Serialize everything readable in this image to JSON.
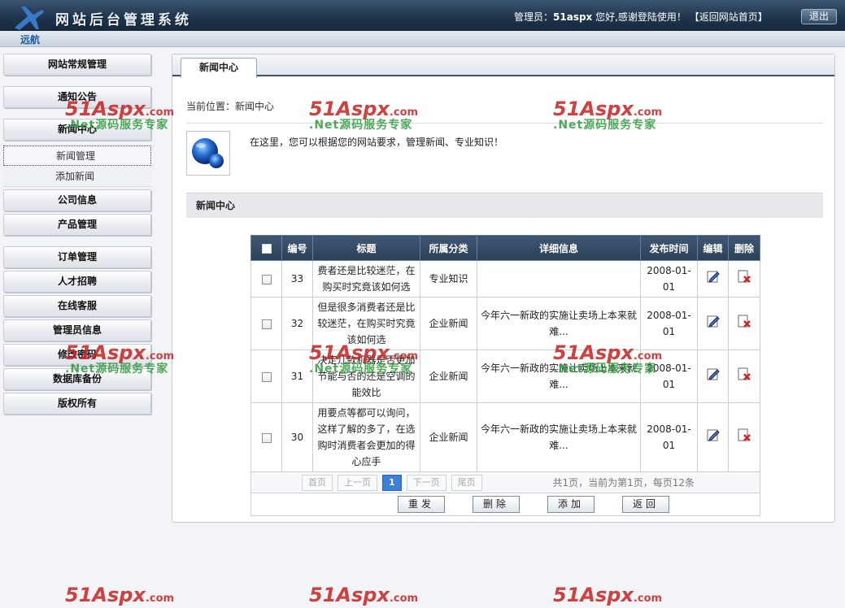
{
  "header": {
    "system_title": "网站后台管理系统",
    "logo_text": "远航",
    "admin_label": "管理员：",
    "admin_name": "51aspx",
    "greeting": " 您好,感谢登陆使用！",
    "home_link": "【返回网站首页】",
    "logout_label": "退出"
  },
  "sidebar": {
    "items": [
      {
        "label": "网站常规管理"
      },
      {
        "label": "通知公告"
      },
      {
        "label": "新闻中心"
      },
      {
        "label": "公司信息"
      },
      {
        "label": "产品管理"
      },
      {
        "label": "订单管理"
      },
      {
        "label": "人才招聘"
      },
      {
        "label": "在线客服"
      },
      {
        "label": "管理员信息"
      },
      {
        "label": "修改密码"
      },
      {
        "label": "数据库备份"
      },
      {
        "label": "版权所有"
      }
    ],
    "sub_items": [
      {
        "label": "新闻管理"
      },
      {
        "label": "添加新闻"
      }
    ]
  },
  "main": {
    "tab_label": "新闻中心",
    "breadcrumb": "当前位置：新闻中心",
    "intro": "在这里，您可以根据您的网站要求，管理新闻、专业知识！",
    "section_title": "新闻中心"
  },
  "table": {
    "headers": {
      "id": "编号",
      "title": "标题",
      "category": "所属分类",
      "detail": "详细信息",
      "date": "发布时间",
      "edit": "编辑",
      "delete": "删除"
    },
    "rows": [
      {
        "id": "33",
        "title": "费者还是比较迷茫，在购买时究竟该如何选",
        "category": "专业知识",
        "detail": "",
        "date": "2008-01-01"
      },
      {
        "id": "32",
        "title": "但是很多消费者还是比较迷茫，在购买时究竟该如何选",
        "category": "企业新闻",
        "detail": "今年六一新政的实施让卖场上本来就难...",
        "date": "2008-01-01"
      },
      {
        "id": "31",
        "title": "决定几款机器是否更加节能与否的还是空调的能效比",
        "category": "企业新闻",
        "detail": "今年六一新政的实施让卖场上本来就难...",
        "date": "2008-01-01"
      },
      {
        "id": "30",
        "title": "用要点等都可以询问，这样了解的多了，在选购时消费者会更加的得心应手",
        "category": "企业新闻",
        "detail": "今年六一新政的实施让卖场上本来就难...",
        "date": "2008-01-01"
      }
    ]
  },
  "pager": {
    "first": "首页",
    "prev": "上一页",
    "current": "1",
    "next": "下一页",
    "last": "尾页",
    "info": "共1页，当前为第1页，每页12条"
  },
  "actions": {
    "resend": "重发",
    "delete": "删除",
    "add": "添加",
    "back": "返回"
  },
  "watermark": {
    "brand": "51Aspx",
    "suffix": ".com",
    "slogan": ".Net源码服务专家"
  },
  "colors": {
    "header_bg": "#1e344b",
    "table_header_bg": "#34495f",
    "accent_blue": "#3d7fd6",
    "watermark_red": "#c52320",
    "watermark_green": "#2f9a3c"
  }
}
